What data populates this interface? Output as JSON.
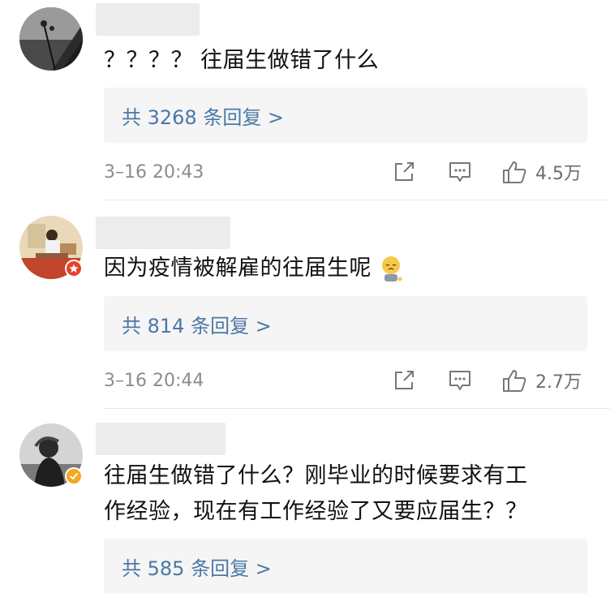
{
  "comments": [
    {
      "text": "？？？？ 往届生做错了什么",
      "reply_link": "共 3268 条回复 >",
      "time": "3–16 20:43",
      "likes": "4.5万"
    },
    {
      "text": "因为疫情被解雇的往届生呢",
      "reply_link": "共 814 条回复 >",
      "time": "3–16 20:44",
      "likes": "2.7万"
    },
    {
      "text_line1": "往届生做错了什么？刚毕业的时候要求有工",
      "text_line2": "作经验，现在有工作经验了又要应届生？？",
      "reply_link": "共 585 条回复 >"
    }
  ],
  "icons": {
    "share": "share-icon",
    "comment": "comment-icon",
    "like": "thumbs-up-icon",
    "emoji": "pensive-emoji-icon"
  },
  "colors": {
    "link": "#4a78a8",
    "secondary_text": "#8c8c8c",
    "reply_bg": "#f5f5f5",
    "red_badge": "#e8412c",
    "gold_badge": "#f5a623"
  }
}
